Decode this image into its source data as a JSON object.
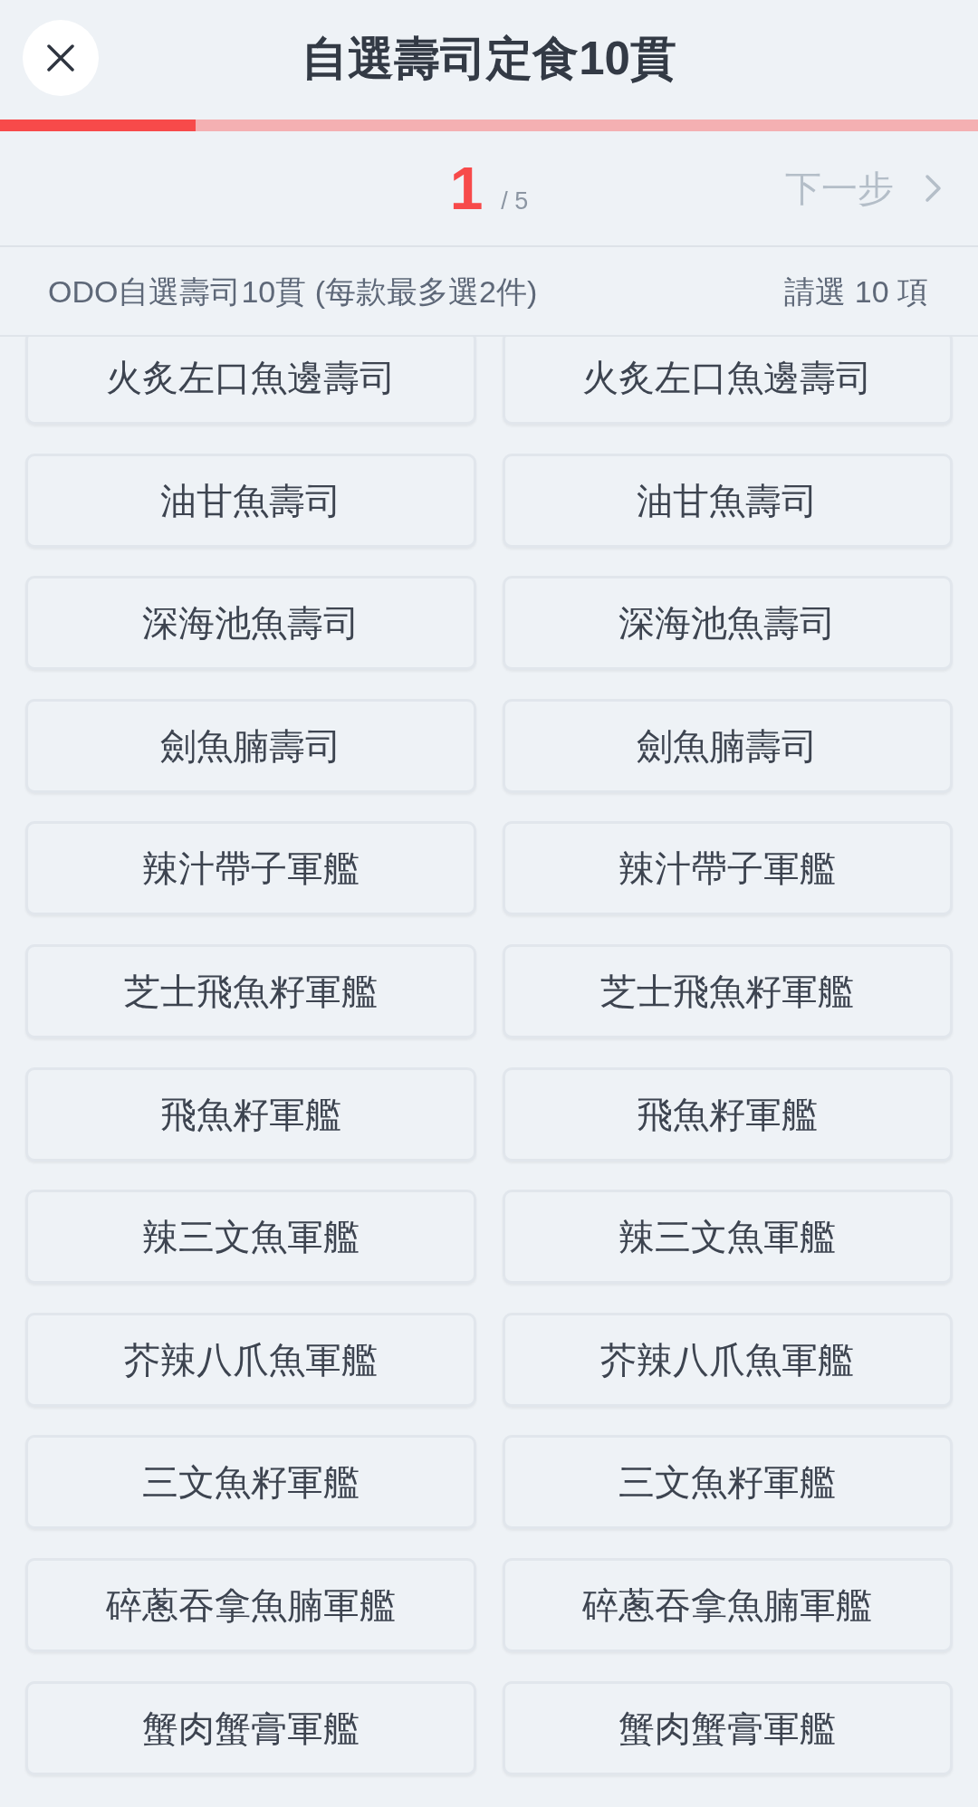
{
  "header": {
    "title": "自選壽司定食10貫"
  },
  "progress": {
    "level": 0.2
  },
  "step": {
    "current": "1",
    "total": "/ 5",
    "next": "下一步"
  },
  "section": {
    "title": "ODO自選壽司10貫 (每款最多選2件)",
    "requirement": "請選 10 項"
  },
  "options": [
    {
      "label": "火炙左口魚邊壽司",
      "selected": false
    },
    {
      "label": "火炙左口魚邊壽司",
      "selected": false
    },
    {
      "label": "油甘魚壽司",
      "selected": false
    },
    {
      "label": "油甘魚壽司",
      "selected": false
    },
    {
      "label": "深海池魚壽司",
      "selected": false
    },
    {
      "label": "深海池魚壽司",
      "selected": false
    },
    {
      "label": "劍魚腩壽司",
      "selected": false
    },
    {
      "label": "劍魚腩壽司",
      "selected": false
    },
    {
      "label": "辣汁帶子軍艦",
      "selected": false
    },
    {
      "label": "辣汁帶子軍艦",
      "selected": false
    },
    {
      "label": "芝士飛魚籽軍艦",
      "selected": false
    },
    {
      "label": "芝士飛魚籽軍艦",
      "selected": false
    },
    {
      "label": "飛魚籽軍艦",
      "selected": false
    },
    {
      "label": "飛魚籽軍艦",
      "selected": false
    },
    {
      "label": "辣三文魚軍艦",
      "selected": false
    },
    {
      "label": "辣三文魚軍艦",
      "selected": false
    },
    {
      "label": "芥辣八爪魚軍艦",
      "selected": false
    },
    {
      "label": "芥辣八爪魚軍艦",
      "selected": false
    },
    {
      "label": "三文魚籽軍艦",
      "selected": false
    },
    {
      "label": "三文魚籽軍艦",
      "selected": false
    },
    {
      "label": "碎蔥吞拿魚腩軍艦",
      "selected": false
    },
    {
      "label": "碎蔥吞拿魚腩軍艦",
      "selected": false
    },
    {
      "label": "蟹肉蟹膏軍艦",
      "selected": false
    },
    {
      "label": "蟹肉蟹膏軍艦",
      "selected": false
    }
  ]
}
